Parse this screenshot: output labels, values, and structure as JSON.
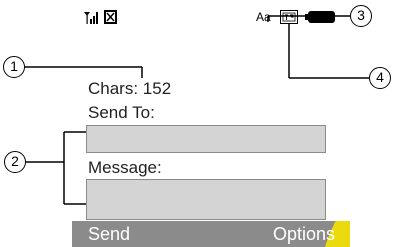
{
  "status_bar": {
    "signal_icon": "signal-strength-icon",
    "message_type_icon": "message-type-icon",
    "text_case": "Aa",
    "t9_icon": "t9-input-icon",
    "battery_icon": "battery-icon"
  },
  "compose": {
    "chars_label": "Chars: 152",
    "send_to_label": "Send To:",
    "send_to_value": "",
    "message_label": "Message:",
    "message_value": ""
  },
  "softkeys": {
    "left": "Send",
    "right": "Options"
  },
  "callouts": [
    "1",
    "2",
    "3",
    "4"
  ],
  "colors": {
    "softkey_bar": "#8b8b8b",
    "field_fill": "#d4d4d4",
    "watermark": "#f5e300"
  }
}
